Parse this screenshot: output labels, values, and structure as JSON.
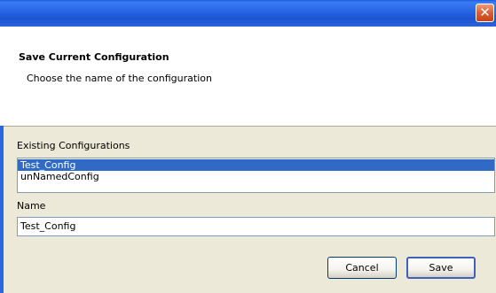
{
  "window": {
    "close_glyph": "✕"
  },
  "header": {
    "title": "Save Current Configuration",
    "subtitle": "Choose the name of the configuration"
  },
  "existing": {
    "label": "Existing Configurations",
    "items": [
      "Test_Config",
      "unNamedConfig"
    ],
    "selected_index": 0
  },
  "name_field": {
    "label": "Name",
    "value": "Test_Config"
  },
  "buttons": {
    "cancel": "Cancel",
    "save": "Save"
  },
  "colors": {
    "titlebar": "#2a67e6",
    "selection": "#316ac5",
    "dialog_bg": "#ece9d8"
  }
}
